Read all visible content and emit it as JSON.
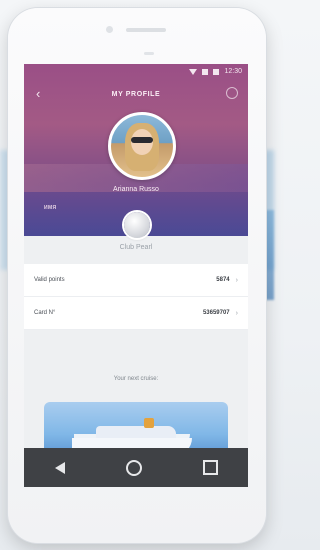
{
  "header": {
    "title": "MY PROFILE",
    "status_time": "12:30"
  },
  "profile": {
    "name": "Arianna Russo",
    "hero_small_text": "ИМЯ",
    "membership": "Club Pearl"
  },
  "details": {
    "rows": [
      {
        "label": "Valid points",
        "value": "5874"
      },
      {
        "label": "Card N°",
        "value": "53659707"
      }
    ]
  },
  "next_cruise": {
    "label": "Your next cruise:"
  },
  "icons": {
    "back": "back-arrow-icon",
    "settings": "gear-icon",
    "nav_back": "nav-back-icon",
    "nav_home": "nav-home-icon",
    "nav_recent": "nav-recent-icon"
  },
  "colors": {
    "hero_top": "#9a4f86",
    "hero_bottom": "#6d5091",
    "nav_bar": "#3f4145"
  }
}
